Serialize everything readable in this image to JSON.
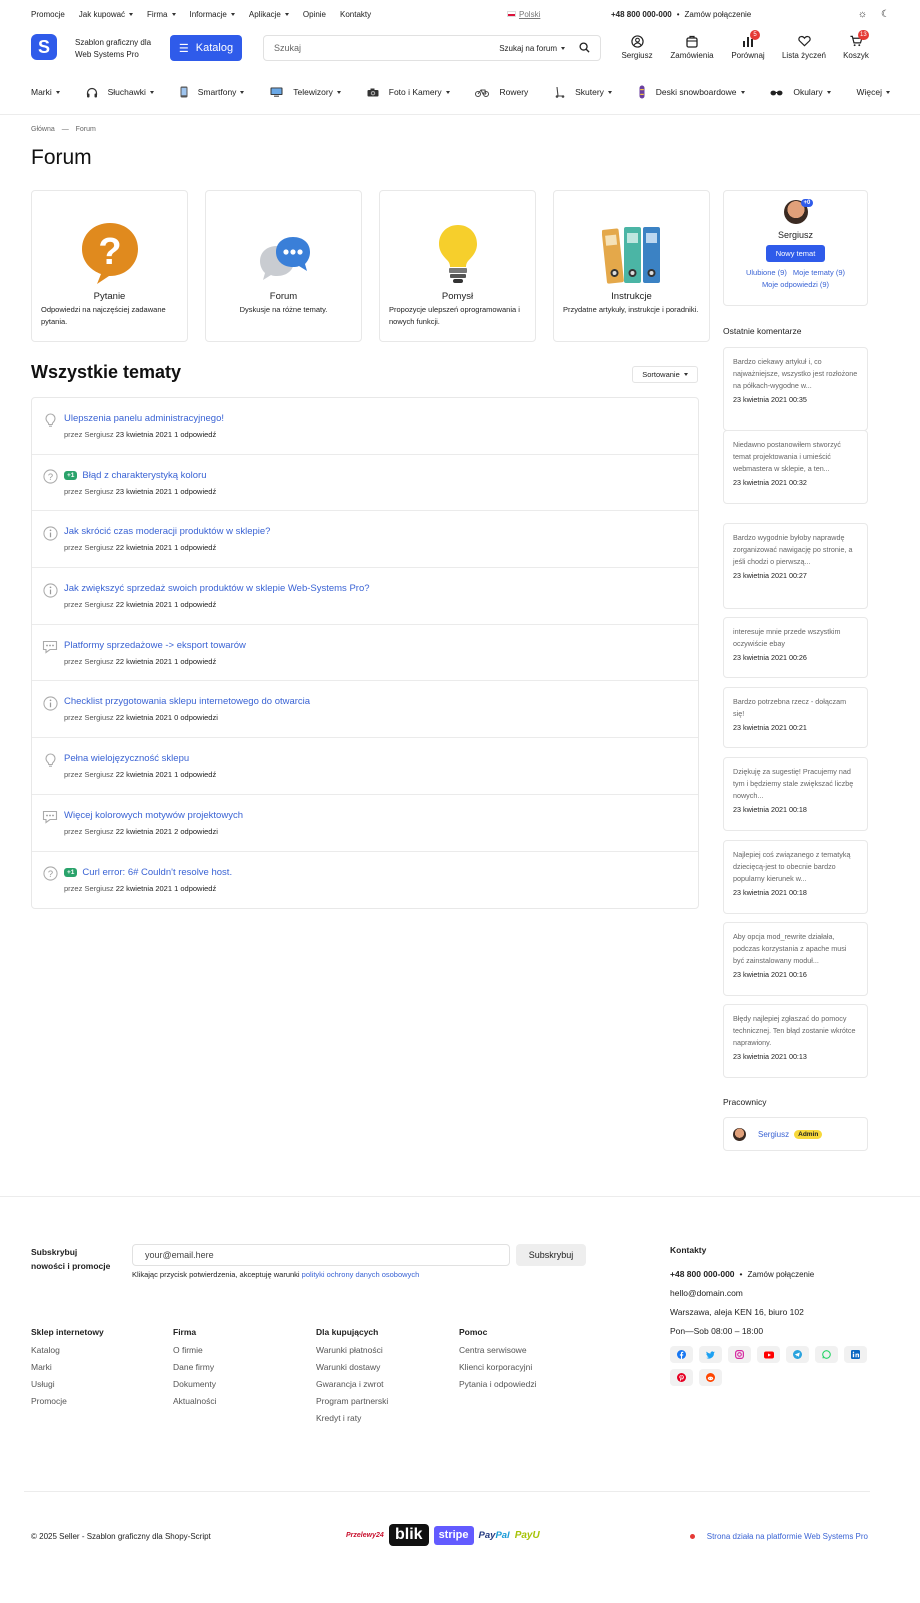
{
  "topbar": {
    "menu": [
      {
        "label": "Promocje",
        "caret": false
      },
      {
        "label": "Jak kupować",
        "caret": true
      },
      {
        "label": "Firma",
        "caret": true
      },
      {
        "label": "Informacje",
        "caret": true
      },
      {
        "label": "Aplikacje",
        "caret": true
      },
      {
        "label": "Opinie",
        "caret": false
      },
      {
        "label": "Kontakty",
        "caret": false
      }
    ],
    "language": "Polski",
    "phone": "+48 800 000-000",
    "callback": "Zamów połączenie"
  },
  "header": {
    "logo_letter": "S",
    "logo_text_line1": "Szablon graficzny dla",
    "logo_text_line2": "Web Systems Pro",
    "catalog_label": "Katalog",
    "search_placeholder": "Szukaj",
    "search_scope": "Szukaj na forum",
    "icons": {
      "profile": "Sergiusz",
      "orders": "Zamówienia",
      "compare": "Porównaj",
      "compare_count": "5",
      "wishlist": "Lista życzeń",
      "cart": "Koszyk",
      "cart_count": "13"
    }
  },
  "nav": [
    {
      "label": "Marki",
      "icon": "",
      "caret": true
    },
    {
      "label": "Słuchawki",
      "icon": "headphones-icon",
      "caret": true
    },
    {
      "label": "Smartfony",
      "icon": "smartphone-icon",
      "caret": true
    },
    {
      "label": "Telewizory",
      "icon": "tv-icon",
      "caret": true
    },
    {
      "label": "Foto i Kamery",
      "icon": "camera-icon",
      "caret": true
    },
    {
      "label": "Rowery",
      "icon": "bicycle-icon",
      "caret": false
    },
    {
      "label": "Skutery",
      "icon": "scooter-icon",
      "caret": true
    },
    {
      "label": "Deski snowboardowe",
      "icon": "snowboard-icon",
      "caret": true
    },
    {
      "label": "Okulary",
      "icon": "glasses-icon",
      "caret": true
    },
    {
      "label": "Więcej",
      "icon": "",
      "caret": true
    }
  ],
  "breadcrumb": {
    "home": "Główna",
    "sep": "—",
    "current": "Forum"
  },
  "page_title": "Forum",
  "categories": [
    {
      "name": "Pytanie",
      "desc": "Odpowiedzi na najczęściej zadawane pytania.",
      "icon": "question-bubble-icon"
    },
    {
      "name": "Forum",
      "desc": "Dyskusje na różne tematy.",
      "icon": "chat-bubbles-icon"
    },
    {
      "name": "Pomysł",
      "desc": "Propozycje ulepszeń oprogramowania i nowych funkcji.",
      "icon": "lightbulb-icon"
    },
    {
      "name": "Instrukcje",
      "desc": "Przydatne artykuły, instrukcje i poradniki.",
      "icon": "binders-icon"
    }
  ],
  "topics_heading": "Wszystkie tematy",
  "sort_label": "Sortowanie",
  "topics": [
    {
      "type": "idea",
      "vote": "",
      "title": "Ulepszenia panelu administracyjnego!",
      "by": "przez",
      "author": "Sergiusz",
      "date": "23 kwietnia 2021",
      "replies": "1 odpowiedź"
    },
    {
      "type": "question",
      "vote": "+1",
      "title": "Błąd z charakterystyką koloru",
      "by": "przez",
      "author": "Sergiusz",
      "date": "23 kwietnia 2021",
      "replies": "1 odpowiedź"
    },
    {
      "type": "info",
      "vote": "",
      "title": "Jak skrócić czas moderacji produktów w sklepie?",
      "by": "przez",
      "author": "Sergiusz",
      "date": "22 kwietnia 2021",
      "replies": "1 odpowiedź"
    },
    {
      "type": "info",
      "vote": "",
      "title": "Jak zwiększyć sprzedaż swoich produktów w sklepie Web-Systems Pro?",
      "by": "przez",
      "author": "Sergiusz",
      "date": "22 kwietnia 2021",
      "replies": "1 odpowiedź"
    },
    {
      "type": "discussion",
      "vote": "",
      "title": "Platformy sprzedażowe -> eksport towarów",
      "by": "przez",
      "author": "Sergiusz",
      "date": "22 kwietnia 2021",
      "replies": "1 odpowiedź"
    },
    {
      "type": "info",
      "vote": "",
      "title": "Checklist przygotowania sklepu internetowego do otwarcia",
      "by": "przez",
      "author": "Sergiusz",
      "date": "22 kwietnia 2021",
      "replies": "0 odpowiedzi"
    },
    {
      "type": "idea",
      "vote": "",
      "title": "Pełna wielojęzyczność sklepu",
      "by": "przez",
      "author": "Sergiusz",
      "date": "22 kwietnia 2021",
      "replies": "1 odpowiedź"
    },
    {
      "type": "discussion",
      "vote": "",
      "title": "Więcej kolorowych motywów projektowych",
      "by": "przez",
      "author": "Sergiusz",
      "date": "22 kwietnia 2021",
      "replies": "2 odpowiedzi"
    },
    {
      "type": "question",
      "vote": "+1",
      "title": "Curl error: 6# Couldn't resolve host.",
      "by": "przez",
      "author": "Sergiusz",
      "date": "22 kwietnia 2021",
      "replies": "1 odpowiedź"
    }
  ],
  "profile": {
    "name": "Sergiusz",
    "badge": "+0",
    "new_topic": "Nowy temat",
    "link_favorites": "Ulubione (9)",
    "link_my_topics": "Moje tematy (9)",
    "link_my_replies": "Moje odpowiedzi (9)"
  },
  "comments_heading": "Ostatnie komentarze",
  "comments": [
    {
      "text": "Bardzo ciekawy artykuł i, co najważniejsze, wszystko jest rozłożone na półkach-wygodne w...",
      "date": "23 kwietnia 2021 00:35"
    },
    {
      "text": "Niedawno postanowiłem stworzyć temat projektowania i umieścić webmastera w sklepie, a ten...",
      "date": "23 kwietnia 2021 00:32"
    },
    {
      "text": "Bardzo wygodnie byłoby naprawdę zorganizować nawigację po stronie, a jeśli chodzi o pierwszą...",
      "date": "23 kwietnia 2021 00:27"
    },
    {
      "text": "interesuje mnie przede wszystkim oczywiście ebay",
      "date": "23 kwietnia 2021 00:26"
    },
    {
      "text": "Bardzo potrzebna rzecz - dołączam się!",
      "date": "23 kwietnia 2021 00:21"
    },
    {
      "text": "Dziękuję za sugestię! Pracujemy nad tym i będziemy stale zwiększać liczbę nowych...",
      "date": "23 kwietnia 2021 00:18"
    },
    {
      "text": "Najlepiej coś związanego z tematyką dziecięcą-jest to obecnie bardzo popularny kierunek w...",
      "date": "23 kwietnia 2021 00:18"
    },
    {
      "text": "Aby opcja mod_rewrite działała, podczas korzystania z apache musi być zainstalowany moduł...",
      "date": "23 kwietnia 2021 00:16"
    },
    {
      "text": "Błędy najlepiej zgłaszać do pomocy technicznej. Ten błąd zostanie wkrótce naprawiony.",
      "date": "23 kwietnia 2021 00:13"
    }
  ],
  "staff_heading": "Pracownicy",
  "staff": {
    "name": "Sergiusz",
    "role": "Admin"
  },
  "footer": {
    "subscribe_line1": "Subskrybuj",
    "subscribe_line2": "nowości i promocje",
    "email_placeholder": "your@email.here",
    "subscribe_button": "Subskrybuj",
    "consent_text": "Klikając przycisk potwierdzenia, akceptuję warunki ",
    "consent_link": "polityki ochrony danych osobowych",
    "columns": [
      {
        "title": "Sklep internetowy",
        "links": [
          "Katalog",
          "Marki",
          "Usługi",
          "Promocje"
        ]
      },
      {
        "title": "Firma",
        "links": [
          "O firmie",
          "Dane firmy",
          "Dokumenty",
          "Aktualności"
        ]
      },
      {
        "title": "Dla kupujących",
        "links": [
          "Warunki płatności",
          "Warunki dostawy",
          "Gwarancja i zwrot",
          "Program partnerski",
          "Kredyt i raty"
        ]
      },
      {
        "title": "Pomoc",
        "links": [
          "Centra serwisowe",
          "Klienci korporacyjni",
          "Pytania i odpowiedzi"
        ]
      }
    ],
    "contacts_title": "Kontakty",
    "phone": "+48 800 000-000",
    "callback": "Zamów połączenie",
    "email": "hello@domain.com",
    "address": "Warszawa, aleja KEN 16, biuro 102",
    "hours": "Pon—Sob 08:00 – 18:00",
    "copyright": "© 2025 Seller - Szablon graficzny dla Shopy-Script",
    "payments": [
      "Przelewy24",
      "blik",
      "stripe",
      "PayPal",
      "PayU"
    ],
    "platform": "Strona działa na platformie Web Systems Pro"
  },
  "colors": {
    "accent": "#2f5bea",
    "link": "#3a63d4",
    "vote": "#2aa36b",
    "badge": "#e53935",
    "admin": "#f7d83a"
  }
}
